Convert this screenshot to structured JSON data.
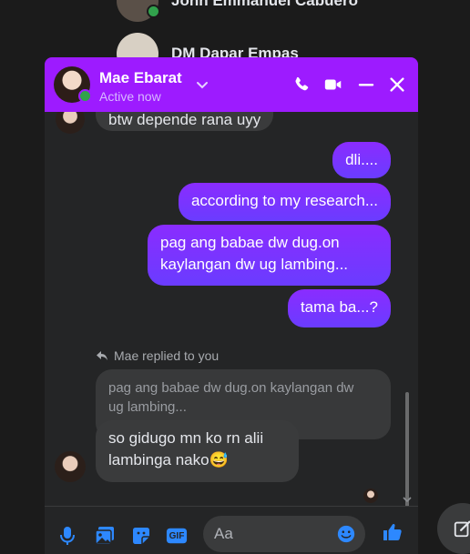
{
  "background_list": {
    "items": [
      {
        "name": "John Emmanuel Cabuero"
      },
      {
        "name": "DM Dapar Empas"
      }
    ]
  },
  "chat": {
    "contact_name": "Mae Ebarat",
    "status": "Active now",
    "accent_color": "#9d1bff",
    "header_icons": [
      "phone-icon",
      "video-icon",
      "minimize-icon",
      "close-icon"
    ]
  },
  "messages": [
    {
      "from": "them",
      "text": "btw depende rana uyy"
    },
    {
      "from": "me",
      "text": "dli...."
    },
    {
      "from": "me",
      "text": "according to my research..."
    },
    {
      "from": "me",
      "lines": [
        "pag ang babae dw dug.on",
        "kaylangan dw ug lambing..."
      ]
    },
    {
      "from": "me",
      "text": "tama ba...?"
    }
  ],
  "reply": {
    "label": "Mae replied to you",
    "quoted_lines": [
      "pag ang babae dw dug.on kaylangan dw",
      "ug lambing..."
    ],
    "lines": [
      "so gidugo mn ko rn alii",
      "lambinga nako😅"
    ]
  },
  "composer": {
    "placeholder": "Aa",
    "icons": [
      "mic-icon",
      "photo-icon",
      "sticker-icon",
      "gif-icon",
      "emoji-icon",
      "like-icon"
    ],
    "gif_label": "GIF"
  }
}
